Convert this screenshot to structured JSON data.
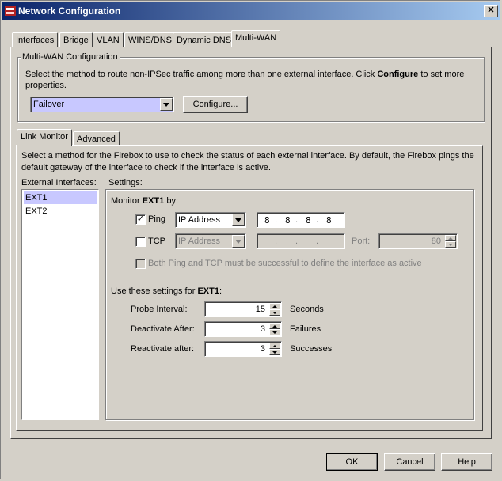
{
  "window": {
    "title": "Network Configuration"
  },
  "tabs": [
    "Interfaces",
    "Bridge",
    "VLAN",
    "WINS/DNS",
    "Dynamic DNS",
    "Multi-WAN"
  ],
  "multiwan": {
    "group_title": "Multi-WAN Configuration",
    "desc_part1": "Select the method to route non-IPSec traffic among more than one external interface. Click ",
    "desc_bold": "Configure",
    "desc_part2": " to set more",
    "desc_line2": "properties.",
    "method_value": "Failover",
    "configure_button": "Configure..."
  },
  "subtabs": [
    "Link Monitor",
    "Advanced"
  ],
  "link_monitor": {
    "desc_line1": "Select a method for the Firebox to use to check the status of each external interface. By default, the Firebox pings the",
    "desc_line2": "default gateway of the interface to check if the interface is active.",
    "external_label": "External Interfaces:",
    "interfaces": [
      "EXT1",
      "EXT2"
    ],
    "settings_label": "Settings:",
    "monitor_prefix": "Monitor ",
    "monitor_iface": "EXT1",
    "monitor_suffix": " by:",
    "ping_label": "Ping",
    "ping_checked": true,
    "ping_type": "IP Address",
    "ping_ip": [
      "8",
      "8",
      "8",
      "8"
    ],
    "tcp_label": "TCP",
    "tcp_checked": false,
    "tcp_type": "IP Address",
    "port_label": "Port:",
    "port_value": "80",
    "both_label": "Both Ping and TCP must be successful to define the interface as active",
    "use_prefix": "Use these settings for ",
    "use_iface": "EXT1",
    "use_suffix": ":",
    "probe_label": "Probe Interval:",
    "probe_value": "15",
    "probe_unit": "Seconds",
    "deact_label": "Deactivate After:",
    "deact_value": "3",
    "deact_unit": "Failures",
    "react_label": "Reactivate after:",
    "react_value": "3",
    "react_unit": "Successes"
  },
  "buttons": {
    "ok": "OK",
    "cancel": "Cancel",
    "help": "Help"
  },
  "colors": {
    "title_start": "#0a246a",
    "title_end": "#a6caf0",
    "selection": "#c8c8ff",
    "face": "#d4d0c8"
  }
}
